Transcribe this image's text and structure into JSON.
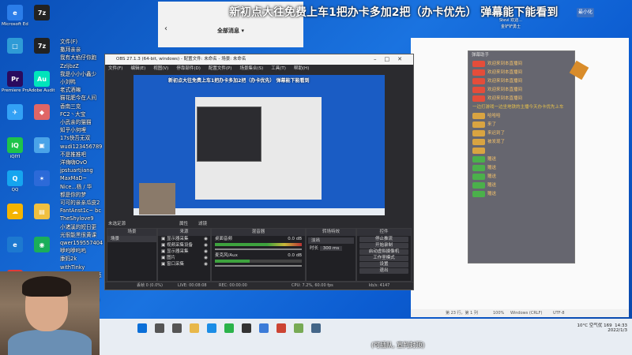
{
  "banner": {
    "text": "新初点大往免费上车1把办卡多加2把（办卡优先） 弹幕能下能看到",
    "minimize_label": "最小化",
    "overlay_user_line1": "Stevi 欢迎...",
    "overlay_user_line2": "金铲铲勇士"
  },
  "phone": {
    "header": "全部消息",
    "back_icon": "back-icon"
  },
  "desktop_icons": [
    {
      "label": "Microsoft Edge",
      "color": "#2b7de9",
      "glyph": "e"
    },
    {
      "label": "",
      "color": "#2e9bd6",
      "glyph": "□"
    },
    {
      "label": "Premiere Pro",
      "color": "#2a0a5e",
      "glyph": "Pr"
    },
    {
      "label": "",
      "color": "#33a1f5",
      "glyph": "✈"
    },
    {
      "label": "iQIYI",
      "color": "#1ec34a",
      "glyph": "iQ"
    },
    {
      "label": "QQ",
      "color": "#16a5ef",
      "glyph": "Q"
    },
    {
      "label": "",
      "color": "#f4b400",
      "glyph": "☁"
    },
    {
      "label": "",
      "color": "#1d79d0",
      "glyph": "e"
    },
    {
      "label": "",
      "color": "#e03a3a",
      "glyph": "◎"
    }
  ],
  "desktop_icons_col2": [
    {
      "label": "",
      "color": "#222",
      "glyph": "7z"
    },
    {
      "label": "",
      "color": "#222",
      "glyph": "7z"
    },
    {
      "label": "Adobe Audition",
      "color": "#00e4bb",
      "glyph": "Au"
    },
    {
      "label": "",
      "color": "#e06666",
      "glyph": "◆"
    },
    {
      "label": "",
      "color": "#4aa3e8",
      "glyph": "▣"
    },
    {
      "label": "",
      "color": "#2c6ad8",
      "glyph": "✶"
    },
    {
      "label": "",
      "color": "#f0c040",
      "glyph": "▤"
    },
    {
      "label": "",
      "color": "#1aae5a",
      "glyph": "◉"
    }
  ],
  "chat_names": [
    "文件(F)",
    "撒拜亲亲",
    "我有大掐仔你跑",
    "ZzljbzZ",
    "我是小小小鑫少",
    "小刘鸭",
    "老式酒嘛",
    "猫花肥今在人间",
    "香南三克",
    "FC2丶大宝",
    "小武亲的猫猫",
    "知乎小何哩",
    "17s快吾无双",
    "wudi123456789",
    "不是推推吧",
    "洋嗨嗨OvO",
    "jpstuartjiang",
    "MaxMaD~",
    "Nice...杨 / 华",
    "都是你的梦",
    "可可的亲亲瓜皮2",
    "FantAnst1c~ bc",
    "TheShylove9",
    "小诸溪的短日更",
    "光很能黑很黄课",
    "qwer159557404",
    "咿呜咿呜呜",
    "康妈2k",
    "withTinky",
    "梅斯东路不喜不悲",
    "网P479455750",
    "TYF~",
    "SuperCassdTea"
  ],
  "obs": {
    "title": "OBS 27.1.3 (64-bit, windows) - 配置文件: 未命名 - 场景: 未命名",
    "menu": [
      "文件(F)",
      "编辑(E)",
      "视图(V)",
      "停靠部件(D)",
      "配置文件(P)",
      "场景集合(S)",
      "工具(T)",
      "帮助(H)"
    ],
    "preview_banner": "新初点大往免费上车1把办卡多加2把（办卡优先） 弹幕能下能看到",
    "dock_scenes": {
      "title": "场景",
      "items": [
        "场景"
      ]
    },
    "dock_sources": {
      "title": "来源",
      "items": [
        "显示器采集",
        "视频采集设备",
        "显示器采集",
        "图片",
        "窗口采集"
      ]
    },
    "dock_mixer": {
      "title": "混音器",
      "tracks": [
        "桌面音频",
        "麦克风/Aux"
      ],
      "db_values": [
        "0.0 dB",
        "0.0 dB"
      ]
    },
    "dock_transitions": {
      "title": "转场特效",
      "type": "淡出",
      "duration_label": "时长",
      "duration_value": "300 ms"
    },
    "dock_controls": {
      "title": "控件",
      "buttons": [
        "停止推流",
        "开始录制",
        "启动虚拟摄像机",
        "工作室模式",
        "设置",
        "退出"
      ]
    },
    "no_source_label": "未选定源",
    "properties_label": "属性",
    "filters_label": "滤镜",
    "status": {
      "dropped": "丢帧 0 (0.0%)",
      "live": "LIVE: 00:08:08",
      "rec": "REC: 00:00:00",
      "cpu": "CPU: 7.2%, 60.00 fps",
      "kbps": "kb/s: 4147"
    }
  },
  "danmaku": {
    "title": "弹幕助手",
    "messages": [
      {
        "badge": "",
        "badge_color": "#e44d3a",
        "user": "",
        "text": "欢迎来到本直播间"
      },
      {
        "badge": "",
        "badge_color": "#e44d3a",
        "user": "",
        "text": "欢迎来到本直播间"
      },
      {
        "badge": "",
        "badge_color": "#e44d3a",
        "user": "",
        "text": "欢迎来到本直播间"
      },
      {
        "badge": "",
        "badge_color": "#e44d3a",
        "user": "",
        "text": "欢迎来到本直播间"
      },
      {
        "badge": "",
        "badge_color": "#e44d3a",
        "user": "",
        "text": "欢迎来到本直播间"
      },
      {
        "badge": "",
        "badge_color": "",
        "user": "",
        "text": "一边打游戏一边坐地铁的主播今天办卡优先上车"
      },
      {
        "badge": "",
        "badge_color": "#d9a441",
        "user": "",
        "text": "哈哈哈"
      },
      {
        "badge": "",
        "badge_color": "#d9a441",
        "user": "",
        "text": "来了"
      },
      {
        "badge": "",
        "badge_color": "#d9a441",
        "user": "",
        "text": "来迟到了"
      },
      {
        "badge": "",
        "badge_color": "#d9a441",
        "user": "",
        "text": "被发现了"
      },
      {
        "badge": "",
        "badge_color": "#d9a441",
        "user": "",
        "text": ""
      },
      {
        "badge": "",
        "badge_color": "#4bb04b",
        "user": "",
        "text": "赠送"
      },
      {
        "badge": "",
        "badge_color": "#4bb04b",
        "user": "",
        "text": "赠送"
      },
      {
        "badge": "",
        "badge_color": "#4bb04b",
        "user": "",
        "text": "赠送"
      },
      {
        "badge": "",
        "badge_color": "#4bb04b",
        "user": "",
        "text": "赠送"
      },
      {
        "badge": "",
        "badge_color": "#4bb04b",
        "user": "",
        "text": "赠送"
      }
    ]
  },
  "editor_status": {
    "position": "第 23 行，第 1 列",
    "zoom": "100%",
    "eol": "Windows (CRLF)",
    "encoding": "UTF-8"
  },
  "taskbar": {
    "weather": "10°C 空气优 169",
    "time": "14:33",
    "date": "2022/1/3",
    "icons": [
      "windows-start-icon",
      "search-icon",
      "task-view-icon",
      "file-explorer-icon",
      "edge-icon",
      "wechat-icon",
      "obs-icon",
      "app-icon",
      "app-icon",
      "app-icon",
      "app-icon"
    ]
  },
  "subtitle": "(可插队, 宣判封顶)",
  "colors": {
    "desktop": "#1a73e0",
    "taskbar": "#e8edf3",
    "obs_bg": "#2b2b2f"
  }
}
